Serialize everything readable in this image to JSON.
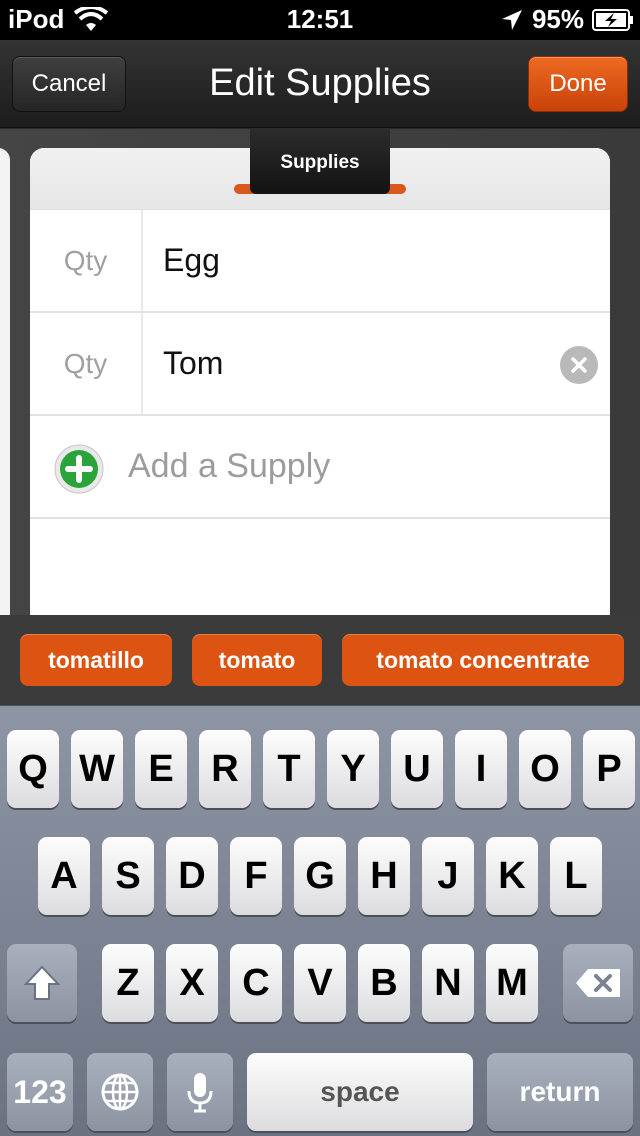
{
  "status": {
    "carrier": "iPod",
    "time": "12:51",
    "battery": "95%"
  },
  "nav": {
    "cancel": "Cancel",
    "title": "Edit Supplies",
    "done": "Done"
  },
  "tab": {
    "label": "Supplies"
  },
  "supplies": [
    {
      "qty_placeholder": "Qty",
      "name": "Egg"
    },
    {
      "qty_placeholder": "Qty",
      "name": "Tom"
    }
  ],
  "add_supply": "Add a Supply",
  "suggestions": [
    "tomatillo",
    "tomato",
    "tomato concentrate"
  ],
  "keyboard": {
    "row1": [
      "Q",
      "W",
      "E",
      "R",
      "T",
      "Y",
      "U",
      "I",
      "O",
      "P"
    ],
    "row2": [
      "A",
      "S",
      "D",
      "F",
      "G",
      "H",
      "J",
      "K",
      "L"
    ],
    "row3": [
      "Z",
      "X",
      "C",
      "V",
      "B",
      "N",
      "M"
    ],
    "numbers": "123",
    "space": "space",
    "return": "return"
  },
  "colors": {
    "accent": "#dd5412",
    "add_green": "#2aa33a"
  }
}
